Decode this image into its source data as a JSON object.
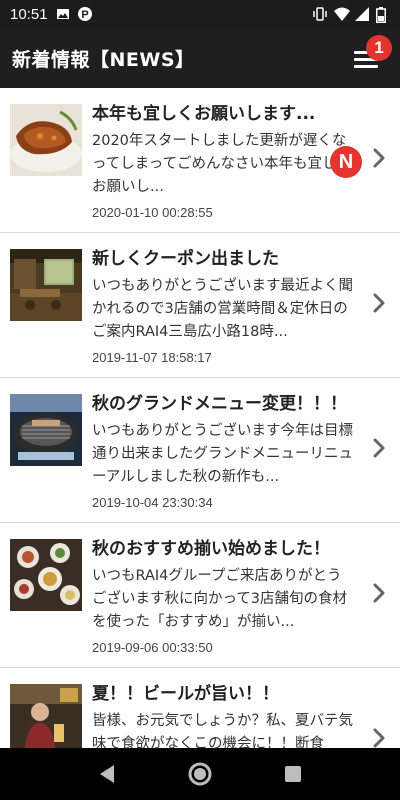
{
  "status_bar": {
    "time": "10:51",
    "left_icons": [
      "image-icon",
      "p-app-icon"
    ],
    "right_icons": [
      "vibrate-icon",
      "wifi-icon",
      "signal-icon",
      "battery-icon"
    ]
  },
  "header": {
    "title": "新着情報【NEWS】",
    "menu_badge": "1",
    "background": "#1f1f1f",
    "badge_color": "#e3342f"
  },
  "news": [
    {
      "title": "本年も宜しくお願いします...",
      "excerpt": "2020年スタートしました更新が遅くなってしまってごめんなさい本年も宜しくお願いし...",
      "date": "2020-01-10 00:28:55",
      "badge": "N",
      "thumb": "grilled-chicken-image"
    },
    {
      "title": "新しくクーポン出ました",
      "excerpt": "いつもありがとうございます最近よく聞かれるので3店舗の営業時間＆定休日のご案内RAI4三島広小路18時...",
      "date": "2019-11-07 18:58:17",
      "badge": "",
      "thumb": "restaurant-interior-image"
    },
    {
      "title": "秋のグランドメニュー変更！！！",
      "excerpt": "いつもありがとうございます今年は目標通り出来ましたグランドメニューリニューアルしました秋の新作も...",
      "date": "2019-10-04 23:30:34",
      "badge": "",
      "thumb": "grill-image"
    },
    {
      "title": "秋のおすすめ揃い始めました！",
      "excerpt": "いつもRAI4グループご来店ありがとうございます秋に向かって3店舗旬の食材を使った「おすすめ」が揃い...",
      "date": "2019-09-06 00:33:50",
      "badge": "",
      "thumb": "dishes-table-image"
    },
    {
      "title": "夏！！ビールが旨い！！",
      "excerpt": "皆様、お元気でしょうか？私、夏バテ気味で食欲がなくこの機会に！！断食",
      "date": "",
      "badge": "",
      "thumb": "bar-person-image"
    }
  ],
  "nav_bar": {
    "buttons": [
      "back-icon",
      "home-icon",
      "recents-icon"
    ]
  }
}
